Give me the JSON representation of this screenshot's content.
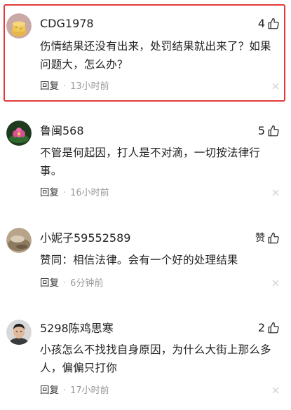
{
  "comments": [
    {
      "username": "CDG1978",
      "likes": "4",
      "text": "伤情结果还没有出来，处罚结果就出来了？如果问题大，怎么办？",
      "reply_label": "回复",
      "time": "13小时前"
    },
    {
      "username": "鲁闽568",
      "likes": "5",
      "text": "不管是何起因，打人是不对滴，一切按法律行事。",
      "reply_label": "回复",
      "time": "16小时前"
    },
    {
      "username": "小妮子59552589",
      "likes": "赞",
      "text": "赞同：相信法律。会有一个好的处理结果",
      "reply_label": "回复",
      "time": "6分钟前"
    },
    {
      "username": "5298陈鸡思寒",
      "likes": "2",
      "text": "小孩怎么不找找自身原因，为什么大街上那么多人，偏偏只打你",
      "reply_label": "回复",
      "time": "17小时前"
    }
  ],
  "meta_separator": "·",
  "colors": {
    "highlight_border": "#e23a3a",
    "meta_text": "#999999",
    "body_text": "#222222"
  },
  "icons": {
    "like": "thumbs-up-icon",
    "close": "close-icon"
  }
}
